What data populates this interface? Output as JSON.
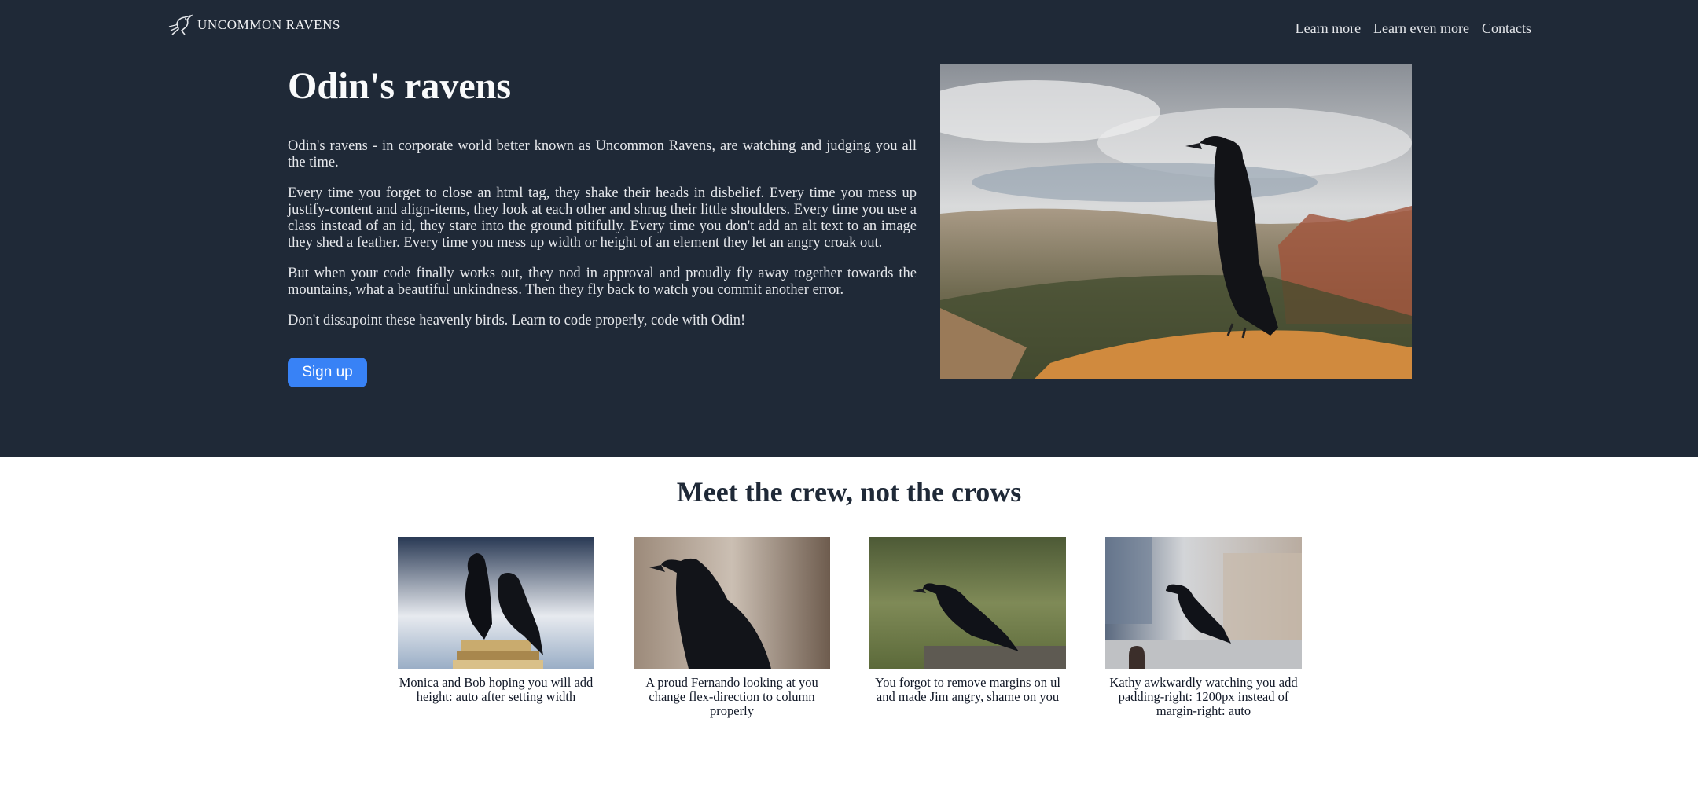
{
  "header": {
    "logo_text": "UNCOMMON RAVENS",
    "logo_icon": "raven-logo-icon",
    "nav": [
      "Learn more",
      "Learn even more",
      "Contacts"
    ]
  },
  "hero": {
    "title": "Odin's ravens",
    "paragraphs": [
      "Odin's ravens - in corporate world better known as Uncommon Ravens, are watching and judging you all the time.",
      "Every time you forget to close an html tag, they shake their heads in disbelief. Every time you mess up justify-content and align-items, they look at each other and shrug their little shoulders. Every time you use a class instead of an id, they stare into the ground pitifully. Every time you don't add an alt text to an image they shed a feather. Every time you mess up width or height of an element they let an angry croak out.",
      "But when your code finally works out, they nod in approval and proudly fly away together towards the mountains, what a beautiful unkindness. Then they fly back to watch you commit another error.",
      "Don't dissapoint these heavenly birds. Learn to code properly, code with Odin!"
    ],
    "signup_label": "Sign up"
  },
  "crew": {
    "title": "Meet the crew, not the crows",
    "cards": [
      {
        "caption": "Monica and Bob hoping you will add height: auto after setting width"
      },
      {
        "caption": "A proud Fernando looking at you change flex-direction to column properly"
      },
      {
        "caption": "You forgot to remove margins on ul and made Jim angry, shame on you"
      },
      {
        "caption": "Kathy awkwardly watching you add padding-right: 1200px instead of margin-right: auto"
      }
    ]
  },
  "colors": {
    "hero_bg": "#1f2937",
    "accent": "#3882f6",
    "crew_title": "#1f2937"
  }
}
